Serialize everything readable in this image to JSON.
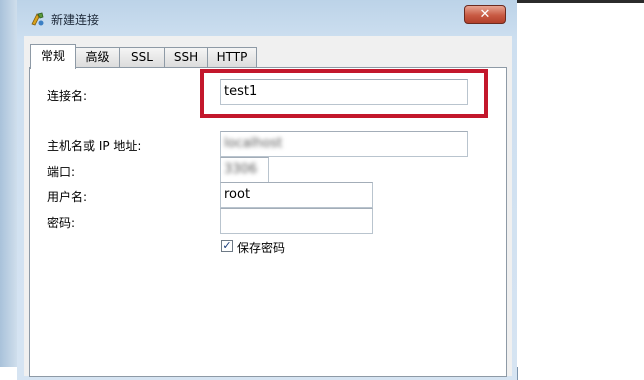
{
  "window": {
    "title": "新建连接",
    "close_label": "✕"
  },
  "tabs": [
    {
      "label": "常规"
    },
    {
      "label": "高级"
    },
    {
      "label": "SSL"
    },
    {
      "label": "SSH"
    },
    {
      "label": "HTTP"
    }
  ],
  "form": {
    "connection_name_label": "连接名:",
    "connection_name_value": "test1",
    "host_label": "主机名或 IP 地址:",
    "host_value": "localhost",
    "port_label": "端口:",
    "port_value": "3306",
    "username_label": "用户名:",
    "username_value": "root",
    "password_label": "密码:",
    "password_value": "",
    "save_password_label": "保存密码",
    "save_password_checked": "✓"
  },
  "colors": {
    "highlight": "#c3172c",
    "titlebar": "#bcd3e8",
    "close_button": "#c85a43"
  }
}
